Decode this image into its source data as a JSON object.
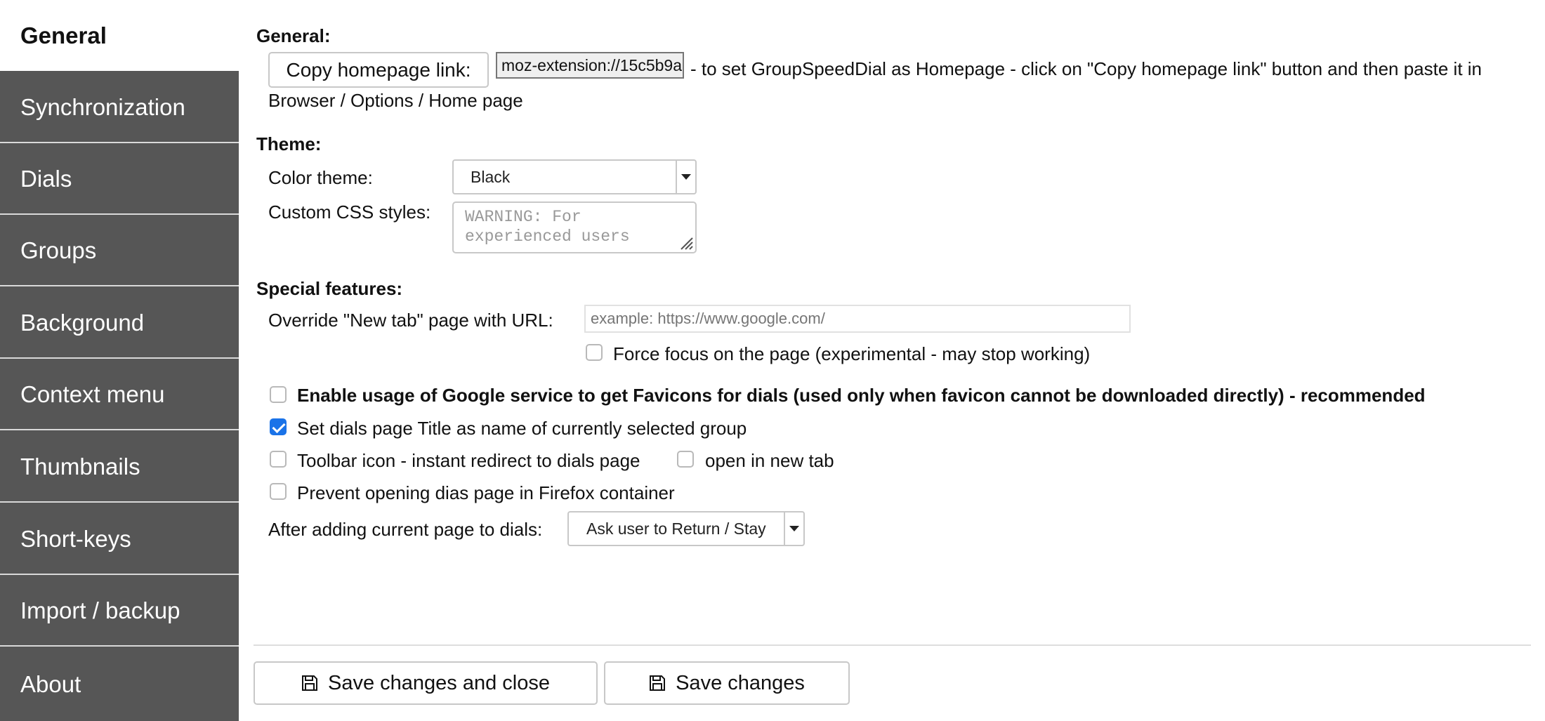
{
  "sidebar": {
    "items": [
      {
        "label": "General"
      },
      {
        "label": "Synchronization"
      },
      {
        "label": "Dials"
      },
      {
        "label": "Groups"
      },
      {
        "label": "Background"
      },
      {
        "label": "Context menu"
      },
      {
        "label": "Thumbnails"
      },
      {
        "label": "Short-keys"
      },
      {
        "label": "Import / backup"
      },
      {
        "label": "About"
      }
    ]
  },
  "general": {
    "title": "General:",
    "copy_button": "Copy homepage link:",
    "homepage_url": "moz-extension://15c5b9a",
    "hint_part1": "- to set GroupSpeedDial as Homepage - click on \"Copy homepage link\" button and then paste it in",
    "hint_part2": "Browser / Options / Home page"
  },
  "theme": {
    "title": "Theme:",
    "color_label": "Color theme:",
    "color_value": "Black",
    "css_label": "Custom CSS styles:",
    "css_placeholder_line1": "WARNING: For",
    "css_placeholder_line2": "experienced users"
  },
  "special": {
    "title": "Special features:",
    "override_label": "Override \"New tab\" page with URL:",
    "override_placeholder": "example: https://www.google.com/",
    "force_focus_label": "Force focus on the page (experimental - may stop working)",
    "favicons_label": "Enable usage of Google service to get Favicons for dials (used only when favicon cannot be downloaded directly) - recommended",
    "title_label": "Set dials page Title as name of currently selected group",
    "toolbar_label": "Toolbar icon - instant redirect to dials page",
    "new_tab_label": "open in new tab",
    "container_label": "Prevent opening dias page in Firefox container",
    "after_label": "After adding current page to dials:",
    "after_value": "Ask user to Return / Stay"
  },
  "checkboxes": {
    "force_focus": false,
    "favicons": false,
    "title": true,
    "toolbar": false,
    "new_tab": false,
    "container": false
  },
  "footer": {
    "save_close": "Save changes and close",
    "save": "Save changes"
  },
  "colors": {
    "sidebar_bg": "#565656",
    "checkbox_checked": "#1a73e8"
  }
}
